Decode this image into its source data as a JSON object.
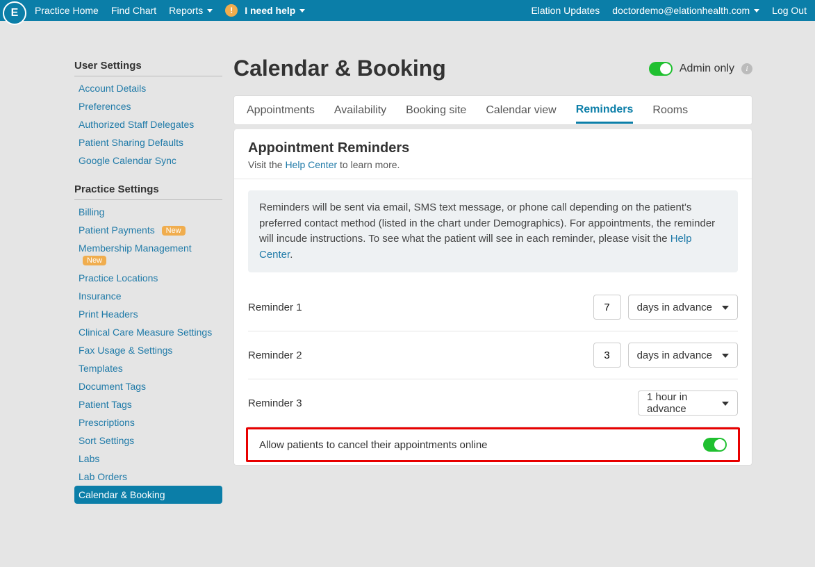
{
  "topnav": {
    "logo": "E",
    "left": [
      "Practice Home",
      "Find Chart",
      "Reports"
    ],
    "help_label": "I need help",
    "right_updates": "Elation Updates",
    "account_email": "doctordemo@elationhealth.com",
    "logout": "Log Out"
  },
  "sidebar": {
    "section1": "User Settings",
    "user_items": [
      "Account Details",
      "Preferences",
      "Authorized Staff Delegates",
      "Patient Sharing Defaults",
      "Google Calendar Sync"
    ],
    "section2": "Practice Settings",
    "practice_items": [
      {
        "label": "Billing"
      },
      {
        "label": "Patient Payments",
        "new": "New"
      },
      {
        "label": "Membership Management",
        "new": "New"
      },
      {
        "label": "Practice Locations"
      },
      {
        "label": "Insurance"
      },
      {
        "label": "Print Headers"
      },
      {
        "label": "Clinical Care Measure Settings"
      },
      {
        "label": "Fax Usage & Settings"
      },
      {
        "label": "Templates"
      },
      {
        "label": "Document Tags"
      },
      {
        "label": "Patient Tags"
      },
      {
        "label": "Prescriptions"
      },
      {
        "label": "Sort Settings"
      },
      {
        "label": "Labs"
      },
      {
        "label": "Lab Orders"
      },
      {
        "label": "Calendar & Booking",
        "active": true
      }
    ]
  },
  "page_title": "Calendar & Booking",
  "admin_only_label": "Admin only",
  "tabs": {
    "items": [
      "Appointments",
      "Availability",
      "Booking site",
      "Calendar view",
      "Reminders",
      "Rooms"
    ],
    "active": "Reminders"
  },
  "body": {
    "title": "Appointment Reminders",
    "sub_pre": "Visit the ",
    "sub_link": "Help Center",
    "sub_post": " to learn more.",
    "notice_pre": "Reminders will be sent via email, SMS text message, or phone call depending on the patient's preferred contact method (listed in the chart under Demographics). For appointments, the reminder will incude instructions. To see what the patient will see in each reminder, please visit the ",
    "notice_link": "Help Center",
    "notice_post": ".",
    "reminders": [
      {
        "label": "Reminder 1",
        "value": "7",
        "unit": "days in advance"
      },
      {
        "label": "Reminder 2",
        "value": "3",
        "unit": "days in advance"
      },
      {
        "label": "Reminder 3",
        "unit": "1 hour in advance"
      }
    ],
    "allow_cancel_label": "Allow patients to cancel their appointments online"
  }
}
